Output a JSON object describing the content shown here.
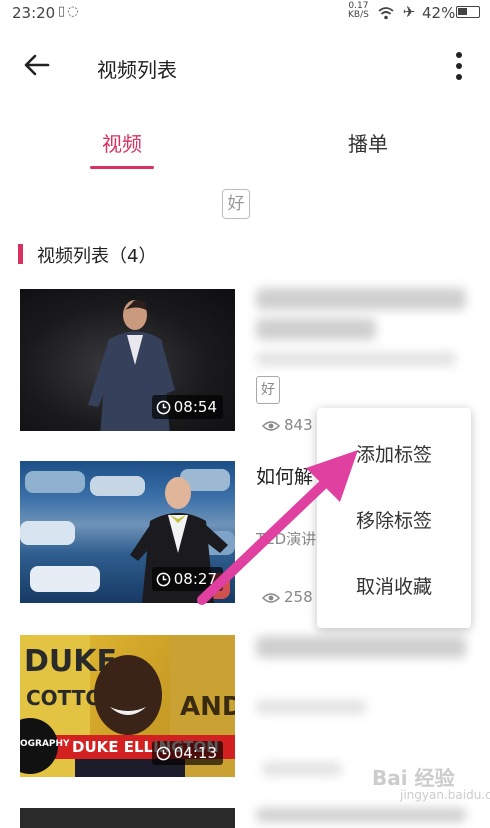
{
  "status_bar": {
    "time": "23:20",
    "net_speed": "0.17",
    "net_unit": "KB/S",
    "battery": "42%"
  },
  "app_bar": {
    "title": "视频列表"
  },
  "tabs": [
    {
      "label": "视频",
      "active": true
    },
    {
      "label": "播单",
      "active": false
    }
  ],
  "badge_label": "好",
  "section": {
    "title": "视频列表（4）"
  },
  "videos": [
    {
      "duration": "08:54",
      "badge": "好",
      "views": "843"
    },
    {
      "title": "如何解",
      "author": "TED演讲",
      "duration": "08:27",
      "views": "258"
    },
    {
      "duration": "04:13",
      "thumb_caption": "DUKE ELLINGTON",
      "thumb_left_text": "OGRAPHY"
    },
    {}
  ],
  "context_menu": {
    "items": [
      {
        "label": "添加标签"
      },
      {
        "label": "移除标签"
      },
      {
        "label": "取消收藏"
      }
    ]
  },
  "colors": {
    "accent": "#d9305f",
    "annotation_arrow": "#e040a0"
  },
  "watermark": {
    "brand": "Bai 经验",
    "url": "jingyan.baidu.com"
  }
}
